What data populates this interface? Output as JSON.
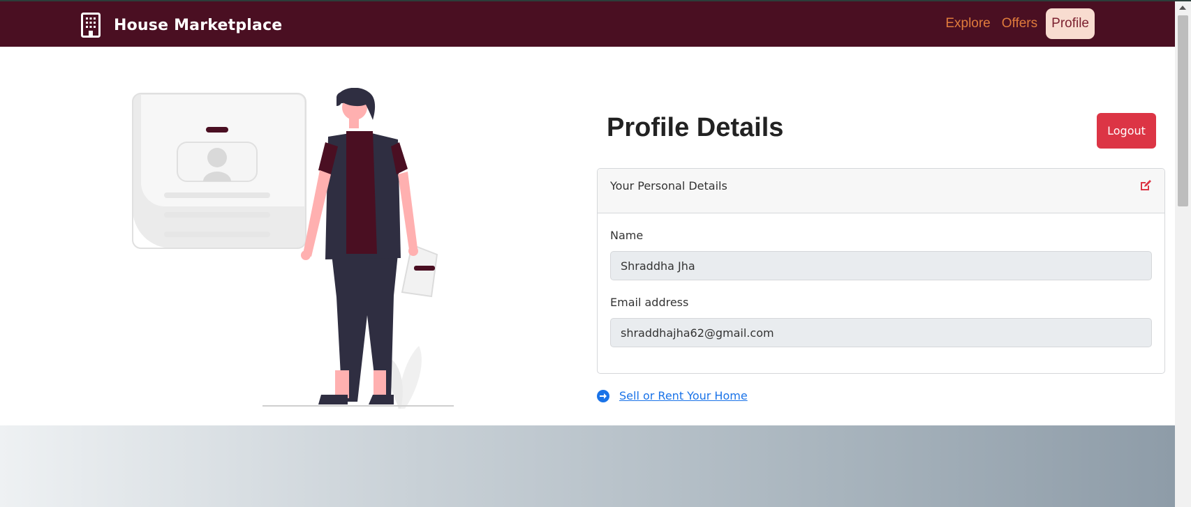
{
  "navbar": {
    "brand_title": "House Marketplace",
    "brand_icon": "building-icon",
    "links": [
      {
        "label": "Explore",
        "active": false
      },
      {
        "label": "Offers",
        "active": false
      },
      {
        "label": "Profile",
        "active": true
      }
    ]
  },
  "profile": {
    "title": "Profile Details",
    "logout_label": "Logout",
    "card": {
      "header_label": "Your Personal Details",
      "edit_icon": "edit-icon",
      "name_label": "Name",
      "name_value": "Shraddha Jha",
      "email_label": "Email address",
      "email_value": "shraddhajha62@gmail.com"
    },
    "sell_link_label": "Sell or Rent Your Home"
  },
  "colors": {
    "navbar_bg": "#4a0f22",
    "nav_link": "#e07b3c",
    "active_link_bg": "#f8dcd0",
    "logout_bg": "#dc3545",
    "link_blue": "#1a73e8"
  }
}
